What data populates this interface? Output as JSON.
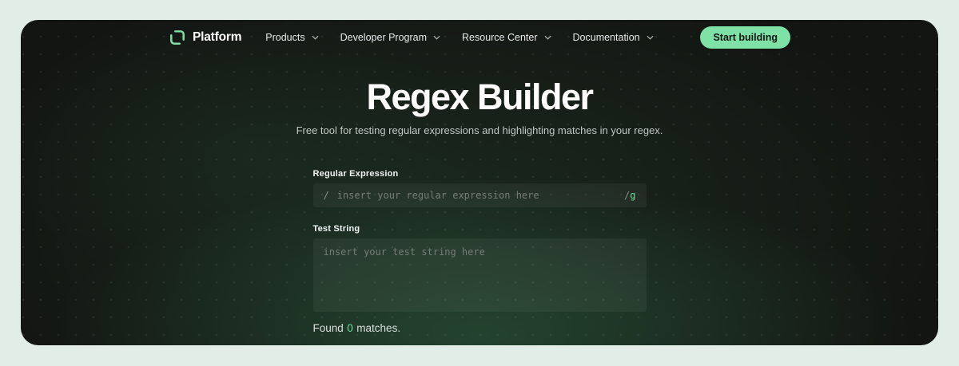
{
  "nav": {
    "brand": "Platform",
    "items": [
      {
        "label": "Products"
      },
      {
        "label": "Developer Program"
      },
      {
        "label": "Resource Center"
      },
      {
        "label": "Documentation"
      }
    ],
    "cta_label": "Start building"
  },
  "hero": {
    "title": "Regex Builder",
    "subtitle": "Free tool for testing regular expressions and highlighting matches in your regex."
  },
  "form": {
    "regex_label": "Regular Expression",
    "regex_open_slash": "/",
    "regex_placeholder": "insert your regular expression here",
    "regex_close_slash": "/",
    "regex_flags": "g",
    "test_label": "Test String",
    "test_placeholder": "insert your test string here"
  },
  "results": {
    "found_prefix": "Found",
    "count": "0",
    "found_suffix": "matches."
  },
  "colors": {
    "page_background": "#e2ede8",
    "panel_background": "#131512",
    "glow_green": "#2a4a38",
    "accent_green": "#7ee2a7",
    "count_green": "#6fdc9c"
  }
}
